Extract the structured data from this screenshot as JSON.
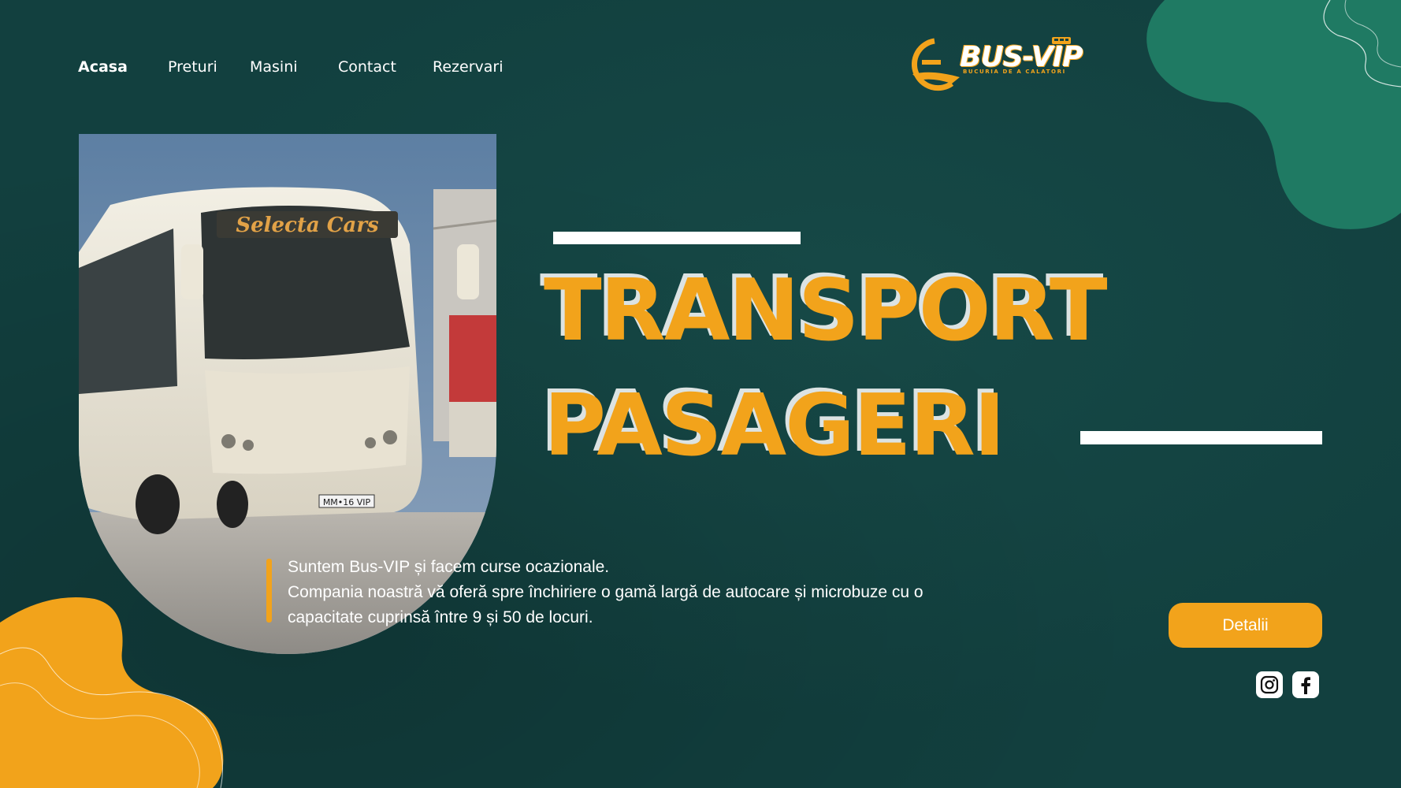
{
  "nav": {
    "items": [
      {
        "label": "Acasa",
        "active": true
      },
      {
        "label": "Preturi",
        "active": false
      },
      {
        "label": "Masini",
        "active": false
      },
      {
        "label": "Contact",
        "active": false
      },
      {
        "label": "Rezervari",
        "active": false
      }
    ]
  },
  "logo": {
    "name": "BUS-VIP",
    "tagline": "BUCURIA DE A CALATORI"
  },
  "hero": {
    "line1": "TRANSPORT",
    "line2": "PASAGERI",
    "photo_bus_sign": "Selecta Cars",
    "photo_plate": "MM•16 VIP"
  },
  "description": {
    "line1": "Suntem Bus-VIP și facem curse ocazionale.",
    "line2": "Compania noastră vă oferă spre închiriere o gamă largă de autocare și microbuze cu o capacitate cuprinsă între 9 și 50 de locuri."
  },
  "cta": {
    "label": "Detalii"
  },
  "social": [
    {
      "icon": "instagram-icon"
    },
    {
      "icon": "facebook-icon"
    }
  ],
  "colors": {
    "background": "#12403f",
    "accent": "#f2a31b",
    "blob_green": "#1f7a63",
    "text": "#ffffff"
  }
}
